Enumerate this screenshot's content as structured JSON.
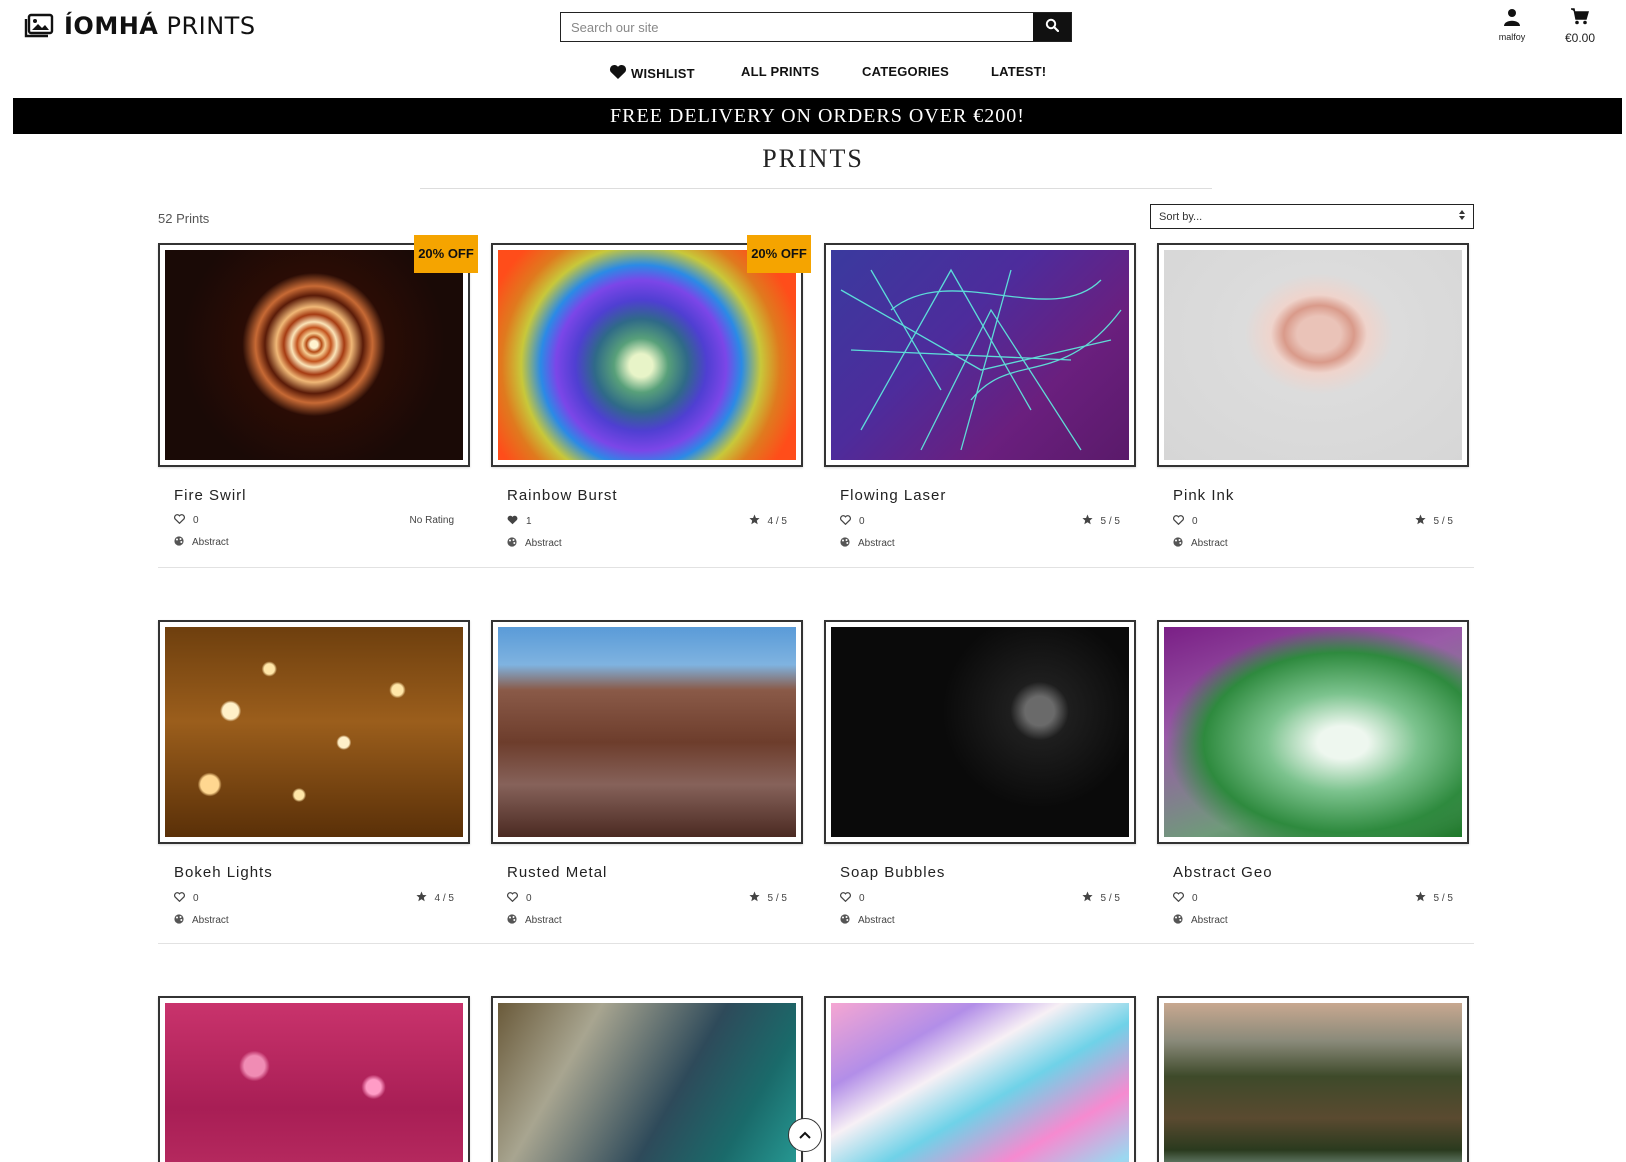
{
  "header": {
    "logo_text_bold": "ÍOMHÁ",
    "logo_text": " PRINTS",
    "search_placeholder": "Search our site",
    "account_label": "malfoy",
    "cart_total": "€0.00"
  },
  "nav": {
    "wishlist": "WISHLIST",
    "all_prints": "ALL PRINTS",
    "categories": "CATEGORIES",
    "latest": "LATEST!"
  },
  "banner": "FREE DELIVERY ON ORDERS OVER €200!",
  "page_title": "PRINTS",
  "count_label": "52 Prints",
  "sort_label": "Sort by...",
  "prints": [
    {
      "title": "Fire Swirl",
      "likes": "0",
      "rating": "No Rating",
      "category": "Abstract",
      "badge": "20% OFF",
      "liked": false
    },
    {
      "title": "Rainbow Burst",
      "likes": "1",
      "rating": "4 / 5",
      "category": "Abstract",
      "badge": "20% OFF",
      "liked": true
    },
    {
      "title": "Flowing Laser",
      "likes": "0",
      "rating": "5 / 5",
      "category": "Abstract",
      "badge": "",
      "liked": false
    },
    {
      "title": "Pink Ink",
      "likes": "0",
      "rating": "5 / 5",
      "category": "Abstract",
      "badge": "",
      "liked": false
    },
    {
      "title": "Bokeh Lights",
      "likes": "0",
      "rating": "4 / 5",
      "category": "Abstract",
      "badge": "",
      "liked": false
    },
    {
      "title": "Rusted Metal",
      "likes": "0",
      "rating": "5 / 5",
      "category": "Abstract",
      "badge": "",
      "liked": false
    },
    {
      "title": "Soap Bubbles",
      "likes": "0",
      "rating": "5 / 5",
      "category": "Abstract",
      "badge": "",
      "liked": false
    },
    {
      "title": "Abstract Geo",
      "likes": "0",
      "rating": "5 / 5",
      "category": "Abstract",
      "badge": "",
      "liked": false
    }
  ],
  "icons": {
    "logo": "image-gallery-icon",
    "search": "search-icon",
    "account": "user-icon",
    "cart": "cart-icon",
    "wishlist": "heart-icon",
    "likes": "heart-outline-icon",
    "rating": "star-icon",
    "category": "palette-icon",
    "sort": "sort-arrows-icon",
    "scroll_top": "chevron-up-icon"
  },
  "colors": {
    "badge": "#f5a400",
    "banner_bg": "#000000",
    "banner_text": "#ffffff"
  }
}
